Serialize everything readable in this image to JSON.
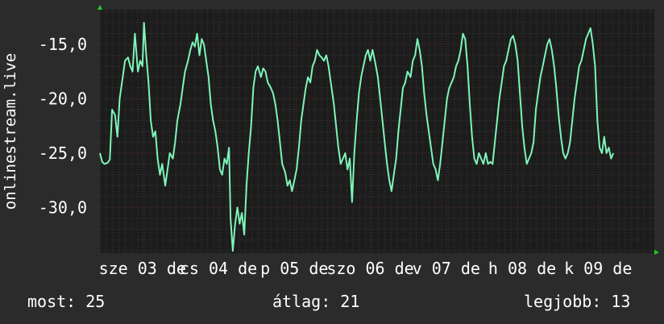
{
  "colors": {
    "background": "#2b2b2b",
    "plot_background": "#1c1c1c",
    "grid_minor": "#3a3a3a",
    "grid_major": "#5a2a2a",
    "series": "#7ef5b8",
    "axis_arrow": "#22cc22",
    "text": "#ffffff"
  },
  "footer": {
    "most": "most: 25",
    "atlag": "átlag: 21",
    "legjobb": "legjobb: 13"
  },
  "chart_data": {
    "type": "line",
    "ylabel": "onlinestream.live",
    "ylim": [
      -34.2,
      -11.8
    ],
    "yticks": [
      -15,
      -20,
      -25,
      -30
    ],
    "ytick_labels": [
      "-15,0",
      "-20,0",
      "-25,0",
      "-30,0"
    ],
    "xlim": [
      0,
      7.3
    ],
    "xtick_positions": [
      0.56,
      1.56,
      2.56,
      3.56,
      4.56,
      5.56,
      6.56
    ],
    "xtick_labels": [
      "sze 03 de",
      "cs 04 de",
      "p 05 de",
      "szo 06 de",
      "v 07 de",
      "h 08 de",
      "k 09 de"
    ],
    "grid": true,
    "series": [
      {
        "values": [
          [
            0.0,
            -25.0
          ],
          [
            0.03,
            -25.8
          ],
          [
            0.06,
            -26.0
          ],
          [
            0.1,
            -25.9
          ],
          [
            0.13,
            -25.6
          ],
          [
            0.16,
            -21.0
          ],
          [
            0.2,
            -21.5
          ],
          [
            0.23,
            -23.5
          ],
          [
            0.26,
            -20.0
          ],
          [
            0.3,
            -18.0
          ],
          [
            0.33,
            -16.5
          ],
          [
            0.37,
            -16.2
          ],
          [
            0.4,
            -17.0
          ],
          [
            0.43,
            -17.5
          ],
          [
            0.46,
            -14.0
          ],
          [
            0.5,
            -17.5
          ],
          [
            0.53,
            -16.5
          ],
          [
            0.56,
            -17.0
          ],
          [
            0.58,
            -13.0
          ],
          [
            0.61,
            -16.0
          ],
          [
            0.64,
            -18.5
          ],
          [
            0.67,
            -22.0
          ],
          [
            0.7,
            -23.5
          ],
          [
            0.73,
            -23.0
          ],
          [
            0.76,
            -25.5
          ],
          [
            0.79,
            -27.0
          ],
          [
            0.82,
            -26.0
          ],
          [
            0.86,
            -28.0
          ],
          [
            0.89,
            -26.5
          ],
          [
            0.92,
            -25.0
          ],
          [
            0.96,
            -25.5
          ],
          [
            0.99,
            -24.0
          ],
          [
            1.02,
            -22.0
          ],
          [
            1.06,
            -20.5
          ],
          [
            1.09,
            -19.0
          ],
          [
            1.12,
            -17.5
          ],
          [
            1.16,
            -16.5
          ],
          [
            1.19,
            -15.5
          ],
          [
            1.22,
            -14.8
          ],
          [
            1.25,
            -15.2
          ],
          [
            1.28,
            -14.0
          ],
          [
            1.31,
            -16.0
          ],
          [
            1.34,
            -14.5
          ],
          [
            1.37,
            -15.0
          ],
          [
            1.4,
            -16.5
          ],
          [
            1.43,
            -18.0
          ],
          [
            1.46,
            -20.5
          ],
          [
            1.49,
            -22.0
          ],
          [
            1.52,
            -23.0
          ],
          [
            1.55,
            -24.5
          ],
          [
            1.58,
            -26.5
          ],
          [
            1.61,
            -27.0
          ],
          [
            1.64,
            -25.5
          ],
          [
            1.67,
            -26.0
          ],
          [
            1.7,
            -24.5
          ],
          [
            1.72,
            -31.0
          ],
          [
            1.75,
            -34.0
          ],
          [
            1.78,
            -31.5
          ],
          [
            1.81,
            -30.0
          ],
          [
            1.84,
            -31.5
          ],
          [
            1.87,
            -30.5
          ],
          [
            1.9,
            -32.5
          ],
          [
            1.93,
            -28.0
          ],
          [
            1.96,
            -25.0
          ],
          [
            1.99,
            -22.5
          ],
          [
            2.02,
            -19.0
          ],
          [
            2.05,
            -17.5
          ],
          [
            2.08,
            -17.0
          ],
          [
            2.12,
            -18.0
          ],
          [
            2.15,
            -17.2
          ],
          [
            2.18,
            -17.5
          ],
          [
            2.21,
            -18.5
          ],
          [
            2.25,
            -19.0
          ],
          [
            2.28,
            -19.5
          ],
          [
            2.31,
            -20.5
          ],
          [
            2.34,
            -22.0
          ],
          [
            2.37,
            -24.0
          ],
          [
            2.4,
            -26.0
          ],
          [
            2.44,
            -26.8
          ],
          [
            2.47,
            -28.0
          ],
          [
            2.5,
            -27.5
          ],
          [
            2.53,
            -28.5
          ],
          [
            2.56,
            -27.5
          ],
          [
            2.59,
            -26.5
          ],
          [
            2.62,
            -24.5
          ],
          [
            2.65,
            -22.0
          ],
          [
            2.68,
            -20.5
          ],
          [
            2.71,
            -19.0
          ],
          [
            2.74,
            -18.0
          ],
          [
            2.77,
            -18.5
          ],
          [
            2.8,
            -17.0
          ],
          [
            2.83,
            -16.5
          ],
          [
            2.86,
            -15.5
          ],
          [
            2.89,
            -16.0
          ],
          [
            2.92,
            -16.2
          ],
          [
            2.95,
            -16.5
          ],
          [
            2.98,
            -16.0
          ],
          [
            3.01,
            -17.0
          ],
          [
            3.04,
            -18.5
          ],
          [
            3.08,
            -20.5
          ],
          [
            3.11,
            -22.5
          ],
          [
            3.14,
            -24.5
          ],
          [
            3.17,
            -26.0
          ],
          [
            3.2,
            -25.5
          ],
          [
            3.23,
            -25.0
          ],
          [
            3.26,
            -26.5
          ],
          [
            3.29,
            -25.5
          ],
          [
            3.32,
            -29.5
          ],
          [
            3.35,
            -25.0
          ],
          [
            3.38,
            -22.0
          ],
          [
            3.41,
            -19.5
          ],
          [
            3.44,
            -18.0
          ],
          [
            3.47,
            -17.0
          ],
          [
            3.5,
            -16.0
          ],
          [
            3.53,
            -15.5
          ],
          [
            3.56,
            -16.5
          ],
          [
            3.59,
            -15.5
          ],
          [
            3.62,
            -16.5
          ],
          [
            3.66,
            -18.0
          ],
          [
            3.69,
            -20.0
          ],
          [
            3.72,
            -22.0
          ],
          [
            3.75,
            -24.0
          ],
          [
            3.78,
            -26.0
          ],
          [
            3.81,
            -27.5
          ],
          [
            3.84,
            -28.5
          ],
          [
            3.87,
            -27.0
          ],
          [
            3.9,
            -25.5
          ],
          [
            3.93,
            -23.0
          ],
          [
            3.96,
            -21.0
          ],
          [
            3.99,
            -19.0
          ],
          [
            4.02,
            -18.5
          ],
          [
            4.05,
            -17.5
          ],
          [
            4.09,
            -18.0
          ],
          [
            4.12,
            -16.5
          ],
          [
            4.15,
            -16.0
          ],
          [
            4.18,
            -14.5
          ],
          [
            4.21,
            -15.5
          ],
          [
            4.24,
            -17.0
          ],
          [
            4.27,
            -19.5
          ],
          [
            4.3,
            -21.5
          ],
          [
            4.33,
            -23.0
          ],
          [
            4.36,
            -24.5
          ],
          [
            4.39,
            -26.0
          ],
          [
            4.42,
            -26.5
          ],
          [
            4.45,
            -27.5
          ],
          [
            4.48,
            -26.0
          ],
          [
            4.51,
            -24.0
          ],
          [
            4.54,
            -22.0
          ],
          [
            4.57,
            -20.0
          ],
          [
            4.6,
            -19.0
          ],
          [
            4.63,
            -18.5
          ],
          [
            4.66,
            -18.0
          ],
          [
            4.69,
            -17.0
          ],
          [
            4.72,
            -16.5
          ],
          [
            4.75,
            -15.5
          ],
          [
            4.78,
            -14.0
          ],
          [
            4.81,
            -14.5
          ],
          [
            4.84,
            -17.0
          ],
          [
            4.87,
            -20.5
          ],
          [
            4.9,
            -23.5
          ],
          [
            4.93,
            -25.5
          ],
          [
            4.96,
            -26.0
          ],
          [
            4.99,
            -25.0
          ],
          [
            5.02,
            -25.5
          ],
          [
            5.05,
            -26.0
          ],
          [
            5.08,
            -25.0
          ],
          [
            5.11,
            -26.0
          ],
          [
            5.14,
            -25.8
          ],
          [
            5.17,
            -26.0
          ],
          [
            5.2,
            -24.0
          ],
          [
            5.23,
            -22.0
          ],
          [
            5.26,
            -20.0
          ],
          [
            5.29,
            -18.5
          ],
          [
            5.32,
            -17.0
          ],
          [
            5.35,
            -16.5
          ],
          [
            5.38,
            -15.5
          ],
          [
            5.41,
            -14.5
          ],
          [
            5.44,
            -14.2
          ],
          [
            5.47,
            -15.0
          ],
          [
            5.5,
            -16.5
          ],
          [
            5.53,
            -19.5
          ],
          [
            5.56,
            -22.5
          ],
          [
            5.59,
            -24.5
          ],
          [
            5.62,
            -26.0
          ],
          [
            5.65,
            -25.5
          ],
          [
            5.68,
            -25.0
          ],
          [
            5.71,
            -24.0
          ],
          [
            5.74,
            -21.0
          ],
          [
            5.77,
            -19.5
          ],
          [
            5.8,
            -18.0
          ],
          [
            5.83,
            -17.0
          ],
          [
            5.86,
            -16.0
          ],
          [
            5.89,
            -15.0
          ],
          [
            5.92,
            -14.5
          ],
          [
            5.95,
            -15.5
          ],
          [
            5.98,
            -17.0
          ],
          [
            6.01,
            -19.0
          ],
          [
            6.04,
            -21.5
          ],
          [
            6.07,
            -23.5
          ],
          [
            6.1,
            -25.0
          ],
          [
            6.13,
            -25.5
          ],
          [
            6.16,
            -25.0
          ],
          [
            6.19,
            -24.0
          ],
          [
            6.22,
            -22.0
          ],
          [
            6.25,
            -20.0
          ],
          [
            6.28,
            -18.5
          ],
          [
            6.31,
            -17.0
          ],
          [
            6.34,
            -16.5
          ],
          [
            6.37,
            -15.5
          ],
          [
            6.4,
            -14.5
          ],
          [
            6.43,
            -14.0
          ],
          [
            6.46,
            -13.5
          ],
          [
            6.49,
            -15.0
          ],
          [
            6.52,
            -17.0
          ],
          [
            6.55,
            -22.0
          ],
          [
            6.58,
            -24.5
          ],
          [
            6.61,
            -25.0
          ],
          [
            6.64,
            -23.5
          ],
          [
            6.67,
            -25.0
          ],
          [
            6.7,
            -24.5
          ],
          [
            6.73,
            -25.5
          ],
          [
            6.76,
            -25.0
          ]
        ]
      }
    ]
  }
}
